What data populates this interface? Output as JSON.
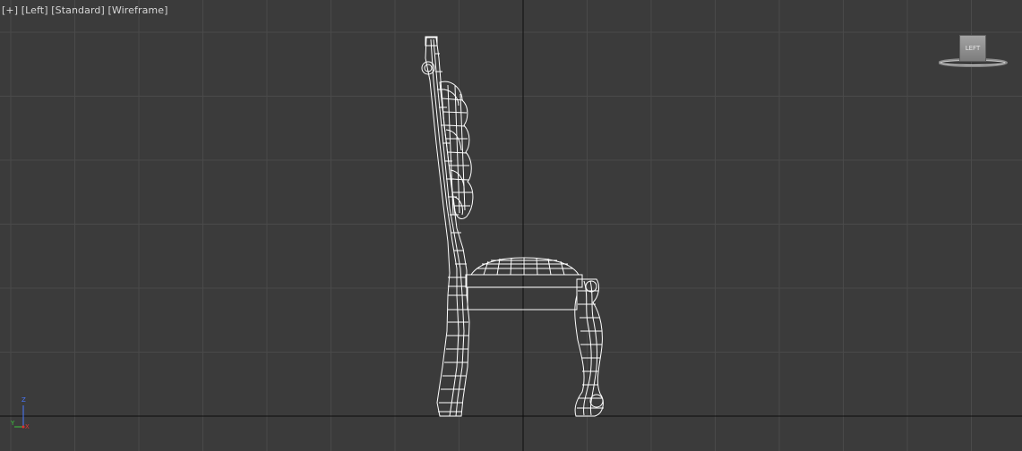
{
  "viewport": {
    "label_parts": [
      "[+]",
      "[Left]",
      "[Standard]",
      "[Wireframe]"
    ],
    "background_color": "#3b3b3b",
    "grid_color": "#4a4a4a",
    "axis_line_color": "#0d0d0d",
    "wire_color": "#ffffff"
  },
  "viewcube": {
    "face_label": "LEFT"
  },
  "axis_tripod": {
    "z_label": "Z",
    "y_label": "Y",
    "x_label": "X",
    "z_color": "#4a78ff",
    "y_color": "#3cc43c",
    "x_color": "#e03030"
  },
  "scene": {
    "object": "chair-wireframe"
  }
}
